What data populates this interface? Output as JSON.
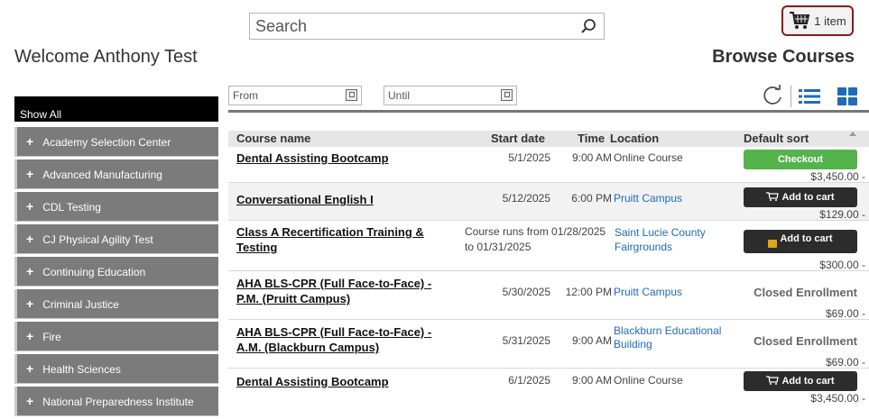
{
  "header": {
    "search_placeholder": "Search",
    "cart_label": "1 item",
    "welcome": "Welcome Anthony Test",
    "browse_title": "Browse Courses"
  },
  "sidebar": {
    "show_all": "Show All",
    "items": [
      {
        "label": "Academy Selection Center"
      },
      {
        "label": "Advanced Manufacturing"
      },
      {
        "label": "CDL Testing"
      },
      {
        "label": "CJ Physical Agility Test"
      },
      {
        "label": "Continuing Education"
      },
      {
        "label": "Criminal Justice"
      },
      {
        "label": "Fire"
      },
      {
        "label": "Health Sciences"
      },
      {
        "label": "National Preparedness Institute"
      }
    ]
  },
  "filters": {
    "from_placeholder": "From",
    "until_placeholder": "Until"
  },
  "table": {
    "columns": {
      "name": "Course name",
      "start": "Start date",
      "time": "Time",
      "location": "Location",
      "sort": "Default sort"
    },
    "rows": [
      {
        "name": "Dental Assisting Bootcamp",
        "date": "5/1/2025",
        "time": "9:00 AM",
        "location": "Online Course",
        "action": "Checkout",
        "price": "$3,450.00 -"
      },
      {
        "name": "Conversational English I",
        "date": "5/12/2025",
        "time": "6:00 PM",
        "location": "Pruitt Campus",
        "action": "Add to cart",
        "price": "$129.00 -"
      },
      {
        "name_line1": "Class A Recertification Training &",
        "name_line2": "Testing",
        "runs_line1": "Course runs from 01/28/2025",
        "runs_line2": "to 01/31/2025",
        "location_line1": "Saint Lucie County",
        "location_line2": "Fairgrounds",
        "action": "Add to cart",
        "price": "$300.00 -"
      },
      {
        "name_line1": "AHA BLS-CPR (Full Face-to-Face) -",
        "name_line2": "P.M. (Pruitt Campus)",
        "date": "5/30/2025",
        "time": "12:00 PM",
        "location": "Pruitt Campus",
        "status": "Closed Enrollment",
        "price": "$69.00 -"
      },
      {
        "name_line1": "AHA BLS-CPR (Full Face-to-Face) -",
        "name_line2": "A.M. (Blackburn Campus)",
        "date": "5/31/2025",
        "time": "9:00 AM",
        "location_line1": "Blackburn Educational",
        "location_line2": "Building",
        "status": "Closed Enrollment",
        "price": "$69.00 -"
      },
      {
        "name": "Dental Assisting Bootcamp",
        "date": "6/1/2025",
        "time": "9:00 AM",
        "location": "Online Course",
        "action": "Add to cart",
        "price": "$3,450.00 -"
      }
    ]
  },
  "colors": {
    "checkout_green": "#55b34b",
    "cart_border": "#8b1a1a",
    "sidebar_gray": "#7b7b7b",
    "link_blue": "#1e6bb8",
    "view_icon_blue": "#1e6bb8"
  }
}
